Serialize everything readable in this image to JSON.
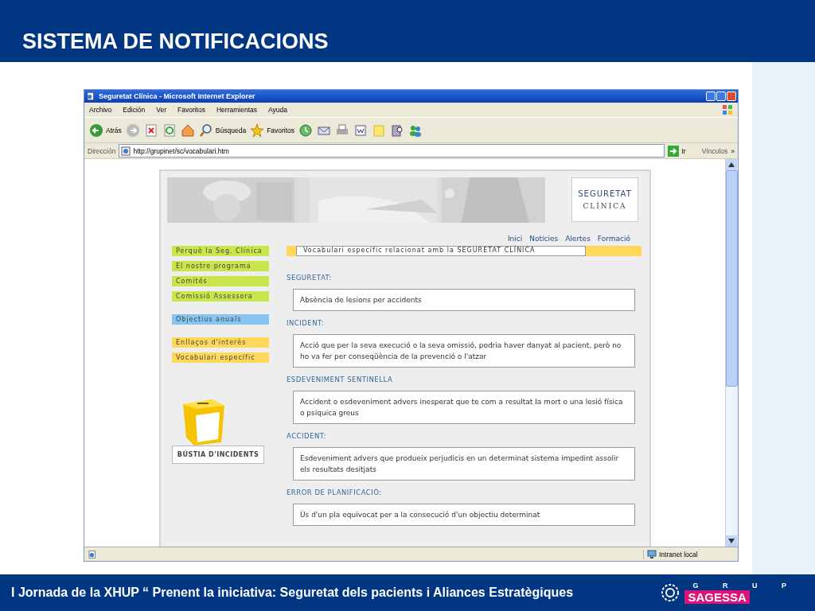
{
  "slide_title": "SISTEMA DE NOTIFICACIONS",
  "browser": {
    "title": "Seguretat Clínica - Microsoft Internet Explorer",
    "menu": [
      "Archivo",
      "Edición",
      "Ver",
      "Favoritos",
      "Herramientas",
      "Ayuda"
    ],
    "toolbar": {
      "back": "Atrás",
      "search": "Búsqueda",
      "favorites": "Favoritos"
    },
    "address": {
      "label": "Dirección",
      "value": "http://grupinet/sc/vocabulari.htm",
      "go": "Ir",
      "links": "Vínculos",
      "more": "»"
    },
    "status": "Intranet local"
  },
  "site": {
    "logo": [
      "SEGURETAT",
      "CLÍNICA"
    ],
    "nav": [
      "Inici",
      "Notícies",
      "Alertes",
      "Formació"
    ],
    "sidebar": [
      {
        "items": [
          {
            "label": "Perquè la Seg. Clínica",
            "color": "#c8e64a"
          },
          {
            "label": "El nostre programa",
            "color": "#c8e64a"
          },
          {
            "label": "Comités",
            "color": "#c8e64a"
          },
          {
            "label": "Comissió Assessora",
            "color": "#c8e64a"
          }
        ]
      },
      {
        "items": [
          {
            "label": "Objectius anuals",
            "color": "#88c4f0"
          }
        ]
      },
      {
        "items": [
          {
            "label": "Enllaços d'interès",
            "color": "#ffd75a"
          },
          {
            "label": "Vocabulari específic",
            "color": "#ffd75a"
          }
        ]
      }
    ],
    "mailbox": {
      "button": "BÚSTIA D'INCIDENTS"
    },
    "heading": "Vocabulari específic relacionat amb la SEGURETAT CLÍNICA",
    "definitions": [
      {
        "term": "SEGURETAT:",
        "text": "Absència de lesions per accidents"
      },
      {
        "term": "INCIDENT:",
        "text": "Acció que per la seva execució o la seva omissió, podria haver danyat al pacient, però no ho va fer per conseqüència de la prevenció o l'atzar"
      },
      {
        "term": "ESDEVENIMENT SENTINELLA",
        "text": "Accident o esdeveniment advers inesperat que te com a resultat la mort o una lesió física o psíquica greus"
      },
      {
        "term": "ACCIDENT:",
        "text": "Esdeveniment advers que produeix perjudicis en un determinat sistema impedint assolir els resultats desitjats"
      },
      {
        "term": "ERROR DE PLANIFICACIÓ:",
        "text": "Ús d'un pla equivocat per a la consecució d'un objectiu determinat"
      }
    ]
  },
  "footer": {
    "text": "I Jornada de la XHUP “ Prenent la iniciativa: Seguretat dels pacients i Aliances Estratègiques",
    "logo_top": "G R U P",
    "logo_name": "SAGESSA"
  }
}
